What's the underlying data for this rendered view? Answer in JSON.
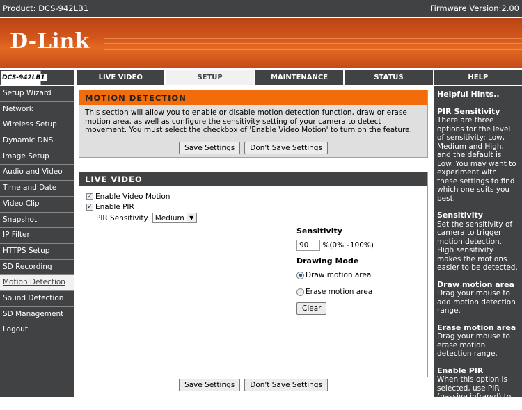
{
  "topbar": {
    "product": "Product: DCS-942LB1",
    "firmware": "Firmware Version:2.00"
  },
  "brand": {
    "logo": "D-Link",
    "model": "DCS-942LB1"
  },
  "tabs": [
    {
      "label": "LIVE VIDEO"
    },
    {
      "label": "SETUP",
      "active": true
    },
    {
      "label": "MAINTENANCE"
    },
    {
      "label": "STATUS"
    },
    {
      "label": "HELP"
    }
  ],
  "sidebar": {
    "items": [
      {
        "label": "Setup Wizard"
      },
      {
        "label": "Network"
      },
      {
        "label": "Wireless Setup"
      },
      {
        "label": "Dynamic DNS"
      },
      {
        "label": "Image Setup"
      },
      {
        "label": "Audio and Video"
      },
      {
        "label": "Time and Date"
      },
      {
        "label": "Video Clip"
      },
      {
        "label": "Snapshot"
      },
      {
        "label": "IP Filter"
      },
      {
        "label": "HTTPS Setup"
      },
      {
        "label": "SD Recording"
      },
      {
        "label": "Motion Detection",
        "active": true
      },
      {
        "label": "Sound Detection"
      },
      {
        "label": "SD Management"
      },
      {
        "label": "Logout"
      }
    ]
  },
  "motion": {
    "title": "MOTION DETECTION",
    "description": "This section will allow you to enable or disable motion detection function, draw or erase motion area, as well as configure the sensitivity setting of your camera to detect movement. You must select the checkbox of 'Enable Video Motion' to turn on the feature.",
    "save": "Save Settings",
    "dont_save": "Don't Save Settings"
  },
  "live": {
    "title": "LIVE VIDEO",
    "enable_motion": {
      "label": "Enable Video Motion",
      "checked": true
    },
    "enable_pir": {
      "label": "Enable PIR",
      "checked": true
    },
    "pir_label": "PIR Sensitivity",
    "pir_value": "Medium",
    "sensitivity_label": "Sensitivity",
    "sensitivity_value": "90",
    "sensitivity_range": "%(0%~100%)",
    "drawing_mode": "Drawing Mode",
    "draw": "Draw motion area",
    "erase": "Erase motion area",
    "selected_mode": "draw",
    "clear": "Clear"
  },
  "bottom": {
    "save": "Save Settings",
    "dont_save": "Don't Save Settings"
  },
  "help": {
    "title": "Helpful Hints..",
    "sections": [
      {
        "h": "PIR Sensitivity",
        "t": "There are three options for the level of sensitivity: Low, Medium and High, and the default is Low. You may want to experiment with these settings to find which one suits you best."
      },
      {
        "h": "Sensitivity",
        "t": "Set the sensitivity of camera to trigger motion detection. High sensitivity makes the motions easier to be detected."
      },
      {
        "h": "Draw motion area",
        "t": "Drag your mouse to add motion detection range."
      },
      {
        "h": "Erase motion area",
        "t": "Drag your mouse to erase motion detection range."
      },
      {
        "h": "Enable PIR",
        "t": "When this option is selected, use PIR (passive infrared) to detect motion."
      }
    ]
  }
}
